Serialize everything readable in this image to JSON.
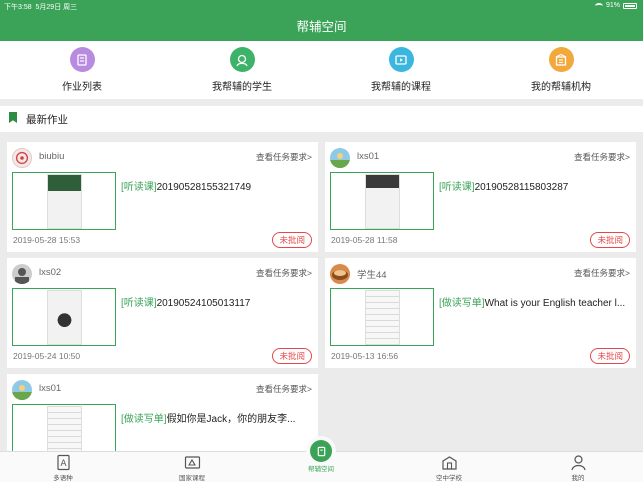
{
  "status_bar": {
    "time": "下午3:58",
    "date": "5月29日 周三",
    "battery": "91%"
  },
  "header": {
    "title": "帮辅空间"
  },
  "quick_nav": [
    {
      "label": "作业列表",
      "color": "#b98be0",
      "icon": "homework-list-icon"
    },
    {
      "label": "我帮辅的学生",
      "color": "#3db36a",
      "icon": "student-icon"
    },
    {
      "label": "我帮辅的课程",
      "color": "#3ab6df",
      "icon": "course-icon"
    },
    {
      "label": "我的帮辅机构",
      "color": "#f2a83b",
      "icon": "institution-icon"
    }
  ],
  "section": {
    "title": "最新作业"
  },
  "cards": [
    {
      "user": "biubiu",
      "requirement": "查看任务要求>",
      "tag": "[听读课]",
      "name": "20190528155321749",
      "date": "2019-05-28 15:53",
      "status": "未批阅"
    },
    {
      "user": "lxs01",
      "requirement": "查看任务要求>",
      "tag": "[听读课]",
      "name": "20190528115803287",
      "date": "2019-05-28 11:58",
      "status": "未批阅"
    },
    {
      "user": "lxs02",
      "requirement": "查看任务要求>",
      "tag": "[听读课]",
      "name": "20190524105013117",
      "date": "2019-05-24 10:50",
      "status": "未批阅"
    },
    {
      "user": "学生44",
      "requirement": "查看任务要求>",
      "tag": "[做读写单]",
      "name": "What is your English teacher l...",
      "date": "2019-05-13 16:56",
      "status": "未批阅"
    },
    {
      "user": "lxs01",
      "requirement": "查看任务要求>",
      "tag": "[做读写单]",
      "name": "假如你是Jack，你的朋友李...",
      "date": "",
      "status": ""
    }
  ],
  "tabbar": {
    "tabs": [
      {
        "label": "多语种",
        "icon": "dictionary-icon"
      },
      {
        "label": "国家课程",
        "icon": "national-course-icon"
      },
      {
        "label": "帮辅空间",
        "icon": "tutoring-space-icon",
        "active": true
      },
      {
        "label": "空中学校",
        "icon": "school-icon"
      },
      {
        "label": "我的",
        "icon": "profile-icon"
      }
    ]
  }
}
